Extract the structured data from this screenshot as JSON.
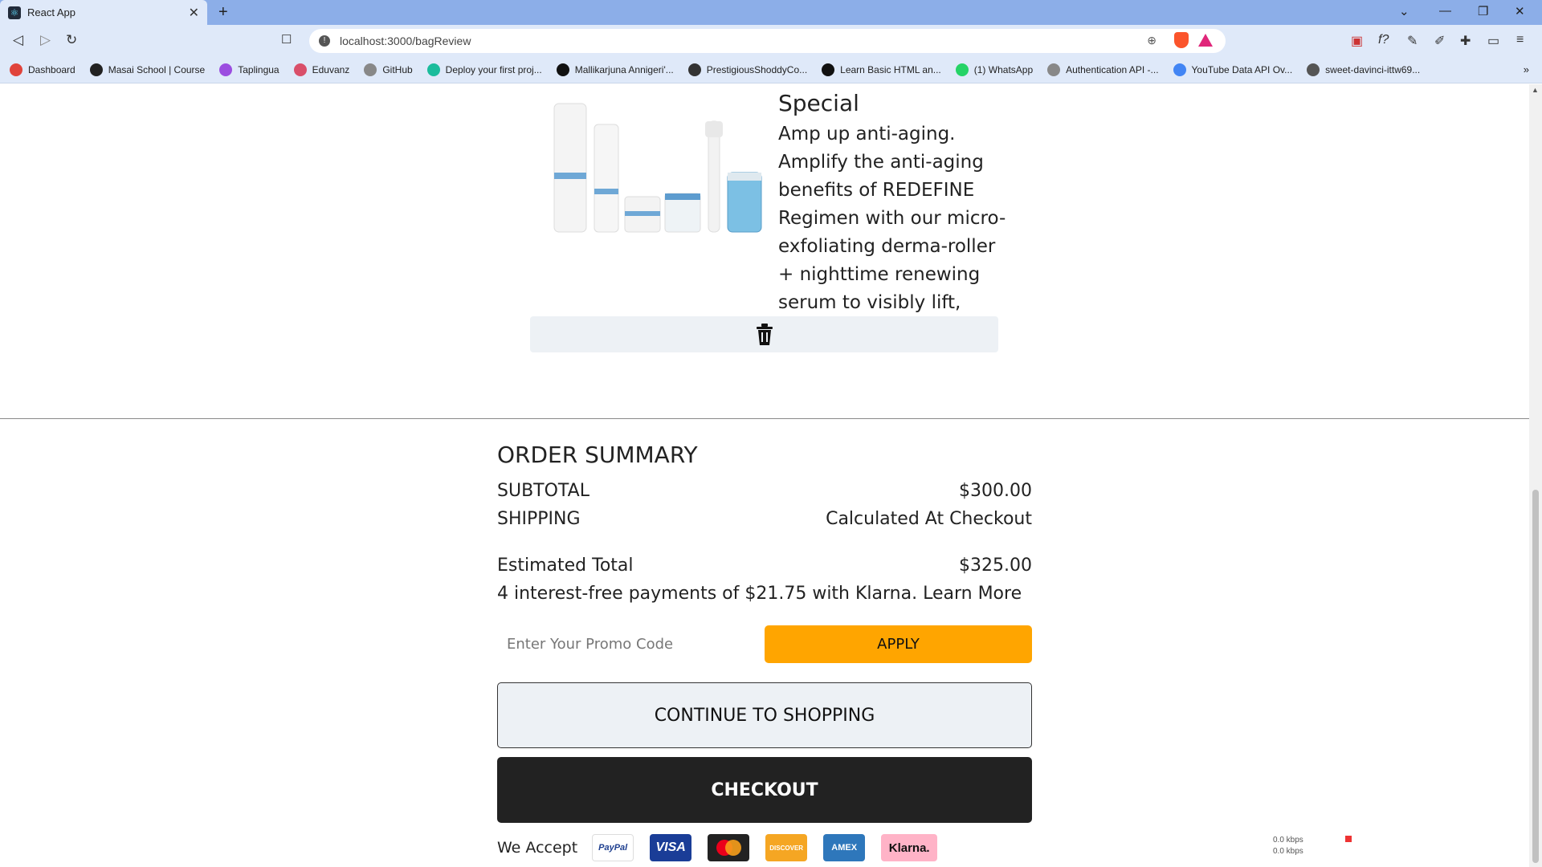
{
  "browser": {
    "tab_title": "React App",
    "tab_close": "✕",
    "new_tab": "+",
    "url": "localhost:3000/bagReview",
    "bookmarks": [
      {
        "label": "Dashboard",
        "color": "#e0433b"
      },
      {
        "label": "Masai School | Course",
        "color": "#222222"
      },
      {
        "label": "Taplingua",
        "color": "#9b4de0"
      },
      {
        "label": "Eduvanz",
        "color": "#d94f6a"
      },
      {
        "label": "GitHub",
        "color": "#888888"
      },
      {
        "label": "Deploy your first proj...",
        "color": "#1abc9c"
      },
      {
        "label": "Mallikarjuna Annigeri'...",
        "color": "#111111"
      },
      {
        "label": "PrestigiousShoddyCo...",
        "color": "#333333"
      },
      {
        "label": "Learn Basic HTML an...",
        "color": "#111111"
      },
      {
        "label": "(1) WhatsApp",
        "color": "#25d366"
      },
      {
        "label": "Authentication API -...",
        "color": "#888888"
      },
      {
        "label": "YouTube Data API Ov...",
        "color": "#4285f4"
      },
      {
        "label": "sweet-davinci-ittw69...",
        "color": "#555555"
      }
    ],
    "bookmarks_more": "»"
  },
  "product": {
    "title": "Special",
    "description": "Amp up anti-aging. Amplify the anti-aging benefits of REDEFINE Regimen with our micro-exfoliating derma-roller + nighttime renewing serum to visibly lift, sculpt + firm.",
    "remove_icon": "trash-icon"
  },
  "summary": {
    "title": "ORDER SUMMARY",
    "subtotal_label": "SUBTOTAL",
    "subtotal_value": "$300.00",
    "shipping_label": "SHIPPING",
    "shipping_value": "Calculated At Checkout",
    "total_label": "Estimated Total",
    "total_value": "$325.00",
    "klarna_text": "4 interest-free payments of $21.75 with Klarna. Learn More",
    "promo_placeholder": "Enter Your Promo Code",
    "apply_label": "APPLY",
    "continue_label": "CONTINUE TO SHOPPING",
    "checkout_label": "CHECKOUT",
    "accept_label": "We Accept",
    "cards": {
      "paypal": "PayPal",
      "visa": "VISA",
      "discover": "DISCOVER",
      "amex": "AMEX",
      "klarna": "Klarna."
    }
  },
  "netspeed": {
    "up": "0.0 kbps",
    "down": "0.0 kbps"
  },
  "colors": {
    "accent_apply": "#ffa500",
    "checkout_bg": "#222222",
    "tabstrip": "#8caee8",
    "toolbar": "#dfe9f9"
  }
}
